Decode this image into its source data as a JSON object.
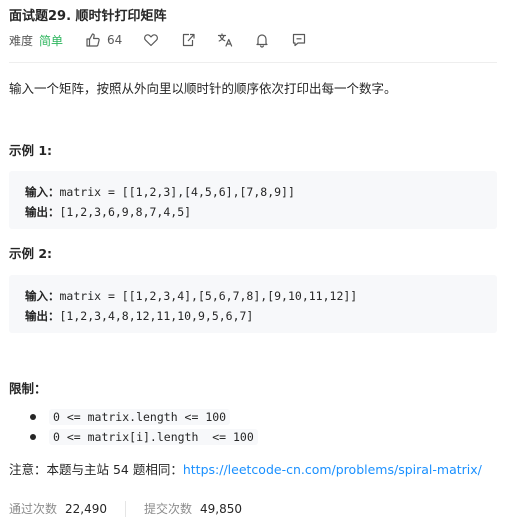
{
  "problem": {
    "title": "面试题29. 顺时针打印矩阵",
    "difficulty_label": "难度",
    "difficulty_value": "简单",
    "likes": "64",
    "description": "输入一个矩阵，按照从外向里以顺时针的顺序依次打印出每一个数字。"
  },
  "colors": {
    "difficulty": "#2db55d",
    "link": "#1a90ff",
    "code_bg": "#f7f8fa"
  },
  "icons": {
    "like": "thumbs-up-icon",
    "favorite": "heart-icon",
    "share": "share-icon",
    "translate": "translate-icon",
    "notify": "bell-icon",
    "feedback": "comment-icon"
  },
  "examples": [
    {
      "title": "示例 1:",
      "input_label": "输入：",
      "input": "matrix = [[1,2,3],[4,5,6],[7,8,9]]",
      "output_label": "输出：",
      "output": "[1,2,3,6,9,8,7,4,5]"
    },
    {
      "title": "示例 2:",
      "input_label": "输入：",
      "input": "matrix = [[1,2,3,4],[5,6,7,8],[9,10,11,12]]",
      "output_label": "输出：",
      "output": "[1,2,3,4,8,12,11,10,9,5,6,7]"
    }
  ],
  "limits": {
    "title": "限制：",
    "items": [
      "0 <= matrix.length <= 100",
      "0 <= matrix[i].length  <= 100"
    ]
  },
  "note": {
    "prefix": "注意：本题与主站 54 题相同：",
    "link": "https://leetcode-cn.com/problems/spiral-matrix/"
  },
  "stats": {
    "accepted_label": "通过次数",
    "accepted_value": "22,490",
    "submissions_label": "提交次数",
    "submissions_value": "49,850"
  }
}
